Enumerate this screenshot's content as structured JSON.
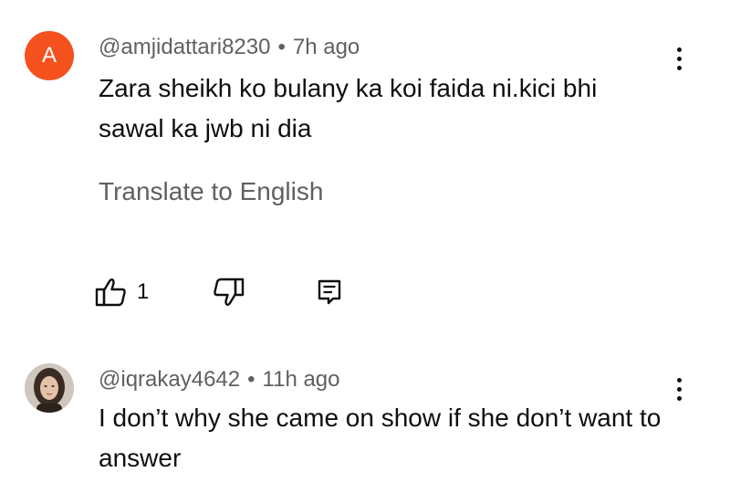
{
  "comments": [
    {
      "avatar_letter": "A",
      "avatar_color": "#f4511e",
      "username": "@amjidattari8230",
      "separator": "•",
      "time": "7h ago",
      "text": "Zara sheikh ko bulany ka koi faida ni.kici bhi sawal ka jwb ni dia",
      "translate_label": "Translate to English",
      "like_count": "1"
    },
    {
      "avatar_icon": "user-photo",
      "username": "@iqrakay4642",
      "separator": "•",
      "time": "11h ago",
      "text": "I don’t why she came on show if she don’t want to answer"
    }
  ],
  "icons": {
    "like": "thumbs-up-icon",
    "dislike": "thumbs-down-icon",
    "reply": "reply-icon",
    "menu": "more-vert-icon"
  }
}
